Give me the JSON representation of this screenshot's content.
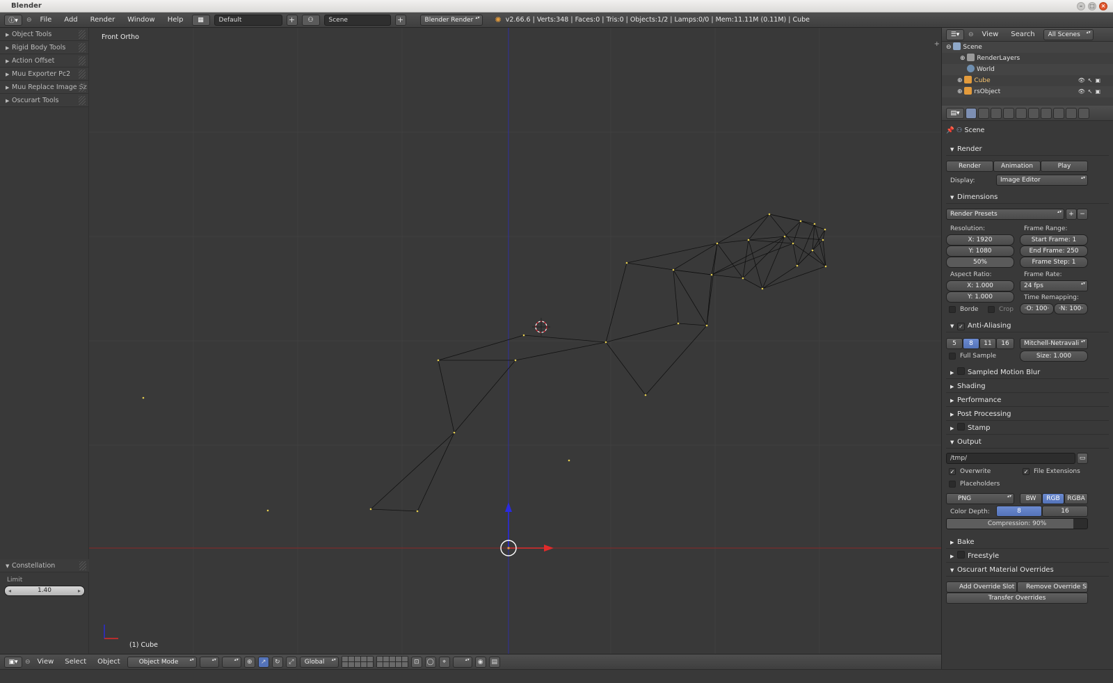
{
  "window": {
    "title": "Blender"
  },
  "info_header": {
    "menus": [
      "File",
      "Add",
      "Render",
      "Window",
      "Help"
    ],
    "screen_layout": "Default",
    "scene": "Scene",
    "render_engine": "Blender Render",
    "stats": "v2.66.6 | Verts:348 | Faces:0 | Tris:0 | Objects:1/2 | Lamps:0/0 | Mem:11.11M (0.11M) | Cube"
  },
  "tool_shelf": {
    "panels": [
      "Object Tools",
      "Rigid Body Tools",
      "Action Offset",
      "Muu Exporter Pc2",
      "Muu Replace Image Sz",
      "Oscurart Tools"
    ],
    "operator_panel": {
      "title": "Constellation",
      "label": "Limit",
      "value": "1.40"
    }
  },
  "viewport": {
    "view_label": "Front Ortho",
    "object_label": "(1) Cube"
  },
  "viewport_header": {
    "menus": [
      "View",
      "Select",
      "Object"
    ],
    "mode": "Object Mode",
    "orientation": "Global"
  },
  "outliner": {
    "header": {
      "view": "View",
      "search": "Search",
      "filter": "All Scenes"
    },
    "items": [
      {
        "label": "Scene",
        "icon_color": "#8fa8c8"
      },
      {
        "label": "RenderLayers",
        "icon_color": "#9a9a9a"
      },
      {
        "label": "World",
        "icon_color": "#6f8fb0"
      },
      {
        "label": "Cube",
        "icon_color": "#e39b3c"
      },
      {
        "label": "rsObject",
        "icon_color": "#e39b3c"
      }
    ]
  },
  "properties": {
    "context": "Scene",
    "render": {
      "title": "Render",
      "render_btn": "Render",
      "animation_btn": "Animation",
      "play_btn": "Play",
      "display_label": "Display:",
      "display_value": "Image Editor"
    },
    "dimensions": {
      "title": "Dimensions",
      "presets": "Render Presets",
      "resolution_label": "Resolution:",
      "res_x": "X: 1920",
      "res_y": "Y: 1080",
      "res_pct": "50%",
      "frame_range_label": "Frame Range:",
      "start": "Start Frame: 1",
      "end": "End Frame: 250",
      "step": "Frame Step: 1",
      "aspect_label": "Aspect Ratio:",
      "aspect_x": "X: 1.000",
      "aspect_y": "Y: 1.000",
      "frame_rate_label": "Frame Rate:",
      "fps": "24 fps",
      "time_remap_label": "Time Remapping:",
      "remap_old": "·O: 100·",
      "remap_new": "·N: 100·",
      "border": "Borde",
      "crop": "Crop"
    },
    "anti_aliasing": {
      "title": "Anti-Aliasing",
      "samples": [
        "5",
        "8",
        "11",
        "16"
      ],
      "selected_sample": "8",
      "filter": "Mitchell-Netravali",
      "full_sample": "Full Sample",
      "size": "Size: 1.000"
    },
    "collapsed_sections": [
      {
        "label": "Sampled Motion Blur",
        "checkbox": true
      },
      {
        "label": "Shading",
        "checkbox": false
      },
      {
        "label": "Performance",
        "checkbox": false
      },
      {
        "label": "Post Processing",
        "checkbox": false
      },
      {
        "label": "Stamp",
        "checkbox": true
      }
    ],
    "output": {
      "title": "Output",
      "path": "/tmp/",
      "overwrite": "Overwrite",
      "file_extensions": "File Extensions",
      "placeholders": "Placeholders",
      "format": "PNG",
      "bw": "BW",
      "rgb": "RGB",
      "rgba": "RGBA",
      "color_depth_label": "Color Depth:",
      "depth_8": "8",
      "depth_16": "16",
      "compression": "Compression: 90%",
      "compression_fraction": 0.9
    },
    "bottom_sections": [
      {
        "label": "Bake",
        "checkbox": false
      },
      {
        "label": "Freestyle",
        "checkbox": true
      }
    ],
    "oscurart": {
      "title": "Oscurart Material Overrides",
      "add": "Add Override Slot",
      "remove": "Remove Override Slo",
      "transfer": "Transfer Overrides"
    }
  },
  "colors": {
    "accent_blue": "#5473b9",
    "x_axis": "#d02020",
    "z_axis": "#2030d0",
    "vertex": "#e8d050"
  }
}
